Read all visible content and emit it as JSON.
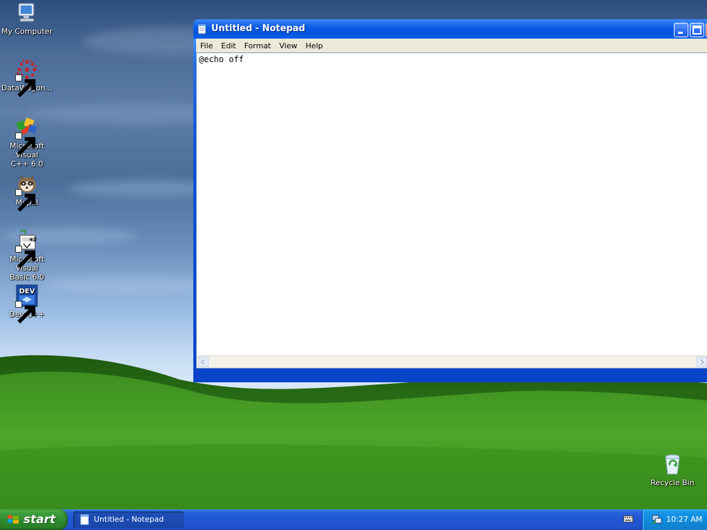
{
  "desktop": {
    "icons": [
      {
        "label": "My Computer"
      },
      {
        "label": "DataWagon..."
      },
      {
        "label_line1": "Microsoft Visual",
        "label_line2": "C++ 6.0"
      },
      {
        "label": "Mypal"
      },
      {
        "label_line1": "Microsoft Visual",
        "label_line2": "Basic 6.0"
      },
      {
        "label": "Dev-C++"
      },
      {
        "label": "Recycle Bin"
      }
    ]
  },
  "notepad": {
    "title": "Untitled - Notepad",
    "menu": [
      "File",
      "Edit",
      "Format",
      "View",
      "Help"
    ],
    "content": "@echo off"
  },
  "taskbar": {
    "start_label": "start",
    "task_label": "Untitled - Notepad",
    "clock": "10:27 AM"
  },
  "colors": {
    "titlebar": "#0553dc",
    "taskbar": "#245edb",
    "start_button": "#318b2f",
    "tray": "#118ad9"
  },
  "icons": {
    "my_computer": "computer-icon",
    "datawagon": "datawagon-icon",
    "msvc": "visual-cpp-icon",
    "mypal": "raccoon-icon",
    "vb6": "visual-basic-icon",
    "devcpp": "dev-cpp-icon",
    "recycle": "recycle-bin-icon"
  }
}
